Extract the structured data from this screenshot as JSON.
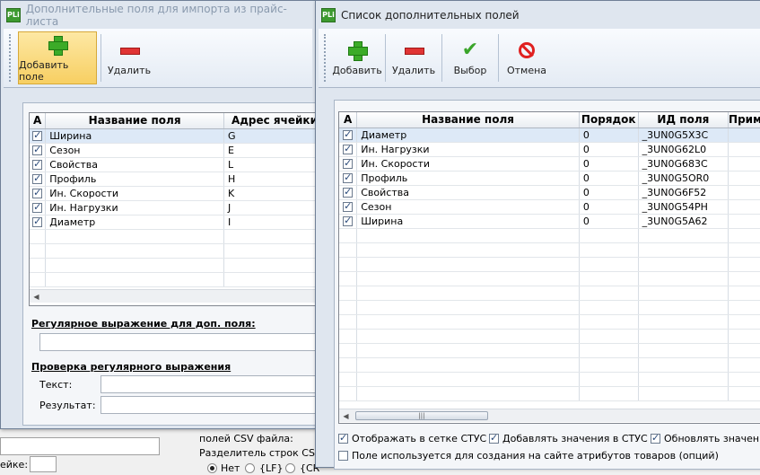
{
  "back_window": {
    "title": "Дополнительные поля для импорта из прайс-листа",
    "toolbar": {
      "add_label": "Добавить поле",
      "delete_label": "Удалить"
    },
    "grid": {
      "columns": [
        "A",
        "Название поля",
        "Адрес ячейки"
      ],
      "rows": [
        {
          "checked": true,
          "name": "Ширина",
          "address": "G"
        },
        {
          "checked": true,
          "name": "Сезон",
          "address": "E"
        },
        {
          "checked": true,
          "name": "Свойства",
          "address": "L"
        },
        {
          "checked": true,
          "name": "Профиль",
          "address": "H"
        },
        {
          "checked": true,
          "name": "Ин. Скорости",
          "address": "K"
        },
        {
          "checked": true,
          "name": "Ин. Нагрузки",
          "address": "J"
        },
        {
          "checked": true,
          "name": "Диаметр",
          "address": "I"
        }
      ]
    },
    "regex_label": "Регулярное выражение для доп. поля:",
    "regex_check_label": "Проверка регулярного выражения",
    "text_label": "Текст:",
    "result_label": "Результат:"
  },
  "main_window": {
    "csv_label": "полей CSV файла:",
    "cell_label": "ейке:",
    "row_sep_label": "Разделитель строк CSV ф",
    "radio_no": "Нет",
    "radio_lf": "{LF}",
    "radio_cr": "{CR"
  },
  "front_window": {
    "title": "Список дополнительных полей",
    "toolbar": {
      "add_label": "Добавить",
      "delete_label": "Удалить",
      "select_label": "Выбор",
      "cancel_label": "Отмена"
    },
    "grid": {
      "columns": [
        "A",
        "Название поля",
        "Порядок",
        "ИД поля",
        "Прим"
      ],
      "rows": [
        {
          "checked": true,
          "name": "Диаметр",
          "order": "0",
          "id": "_3UN0G5X3C"
        },
        {
          "checked": true,
          "name": "Ин. Нагрузки",
          "order": "0",
          "id": "_3UN0G62L0"
        },
        {
          "checked": true,
          "name": "Ин. Скорости",
          "order": "0",
          "id": "_3UN0G683C"
        },
        {
          "checked": true,
          "name": "Профиль",
          "order": "0",
          "id": "_3UN0G5OR0"
        },
        {
          "checked": true,
          "name": "Свойства",
          "order": "0",
          "id": "_3UN0G6F52"
        },
        {
          "checked": true,
          "name": "Сезон",
          "order": "0",
          "id": "_3UN0G54PH"
        },
        {
          "checked": true,
          "name": "Ширина",
          "order": "0",
          "id": "_3UN0G5A62"
        }
      ]
    },
    "options": {
      "show_in_grid": "Отображать в сетке СТУС",
      "add_values": "Добавлять значения в СТУС",
      "update_values": "Обновлять значения",
      "site_attributes": "Поле используется для создания на сайте атрибутов товаров (опций)"
    }
  },
  "colors": {
    "selection": "#dde9f7",
    "accent_pressed": "#f7cf62",
    "add_icon": "#3cab28",
    "delete_icon": "#e03434"
  }
}
